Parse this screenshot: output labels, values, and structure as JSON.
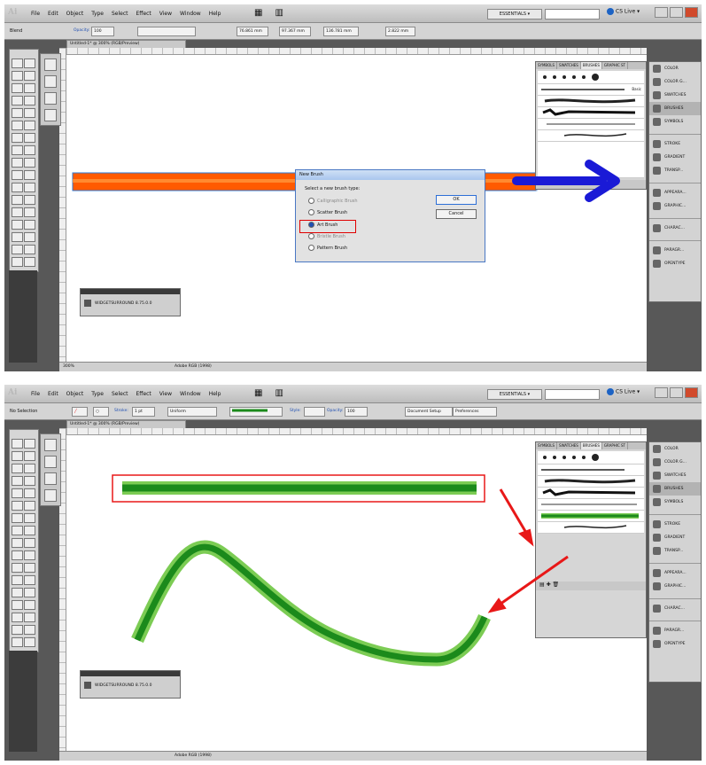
{
  "menubar": {
    "logo": "Ai",
    "items": [
      "File",
      "Edit",
      "Object",
      "Type",
      "Select",
      "Effect",
      "View",
      "Window",
      "Help"
    ],
    "workspace": "ESSENTIALS ▾",
    "cs_live": "CS Live ▾"
  },
  "screen1": {
    "selection_label": "Blend",
    "control": {
      "opacity_label": "Opacity:",
      "opacity_value": "100",
      "x_value": "76.861 mm",
      "y_value": "97.367 mm",
      "w_value": "136.781 mm",
      "h_value": "2.822 mm"
    },
    "doc_tab": "Untitled-1* @ 300% (RGB/Preview)",
    "status_zoom": "300%",
    "status_info": "Adobe RGB (1998)",
    "plugin_label": "WIDGETSURROUND 8.75.0.0",
    "dialog": {
      "title": "New Brush",
      "prompt": "Select a new brush type:",
      "options": [
        "Calligraphic Brush",
        "Scatter Brush",
        "Art Brush",
        "Bristle Brush",
        "Pattern Brush"
      ],
      "ok": "OK",
      "cancel": "Cancel"
    },
    "brush_label": "Basic"
  },
  "screen2": {
    "selection_label": "No Selection",
    "control": {
      "stroke_label": "Stroke:",
      "stroke_value": "1 pt",
      "uniform": "Uniform",
      "style_label": "Style:",
      "opacity_label": "Opacity:",
      "opacity_value": "100",
      "doc_setup": "Document Setup",
      "preferences": "Preferences"
    },
    "doc_tab": "Untitled-1* @ 300% (RGB/Preview)",
    "status_info": "Adobe RGB (1998)",
    "plugin_label": "WIDGETSURROUND 8.75.0.0"
  },
  "brush_tabs": [
    "SYMBOLS",
    "SWATCHES",
    "BRUSHES",
    "GRAPHIC ST"
  ],
  "panels": [
    "COLOR",
    "COLOR G...",
    "SWATCHES",
    "BRUSHES",
    "SYMBOLS",
    "STROKE",
    "GRADIENT",
    "TRANSP...",
    "APPEARA...",
    "GRAPHIC...",
    "CHARAC...",
    "PARAGR...",
    "OPENTYPE"
  ],
  "colors": {
    "orange_bar": "#ff5a00",
    "blue_arrow": "#1a1ad6",
    "green_stroke": "#1b8a1b",
    "green_light": "#7ccc54",
    "red_annot": "#e81818",
    "dialog_accent": "#4a78c4"
  }
}
